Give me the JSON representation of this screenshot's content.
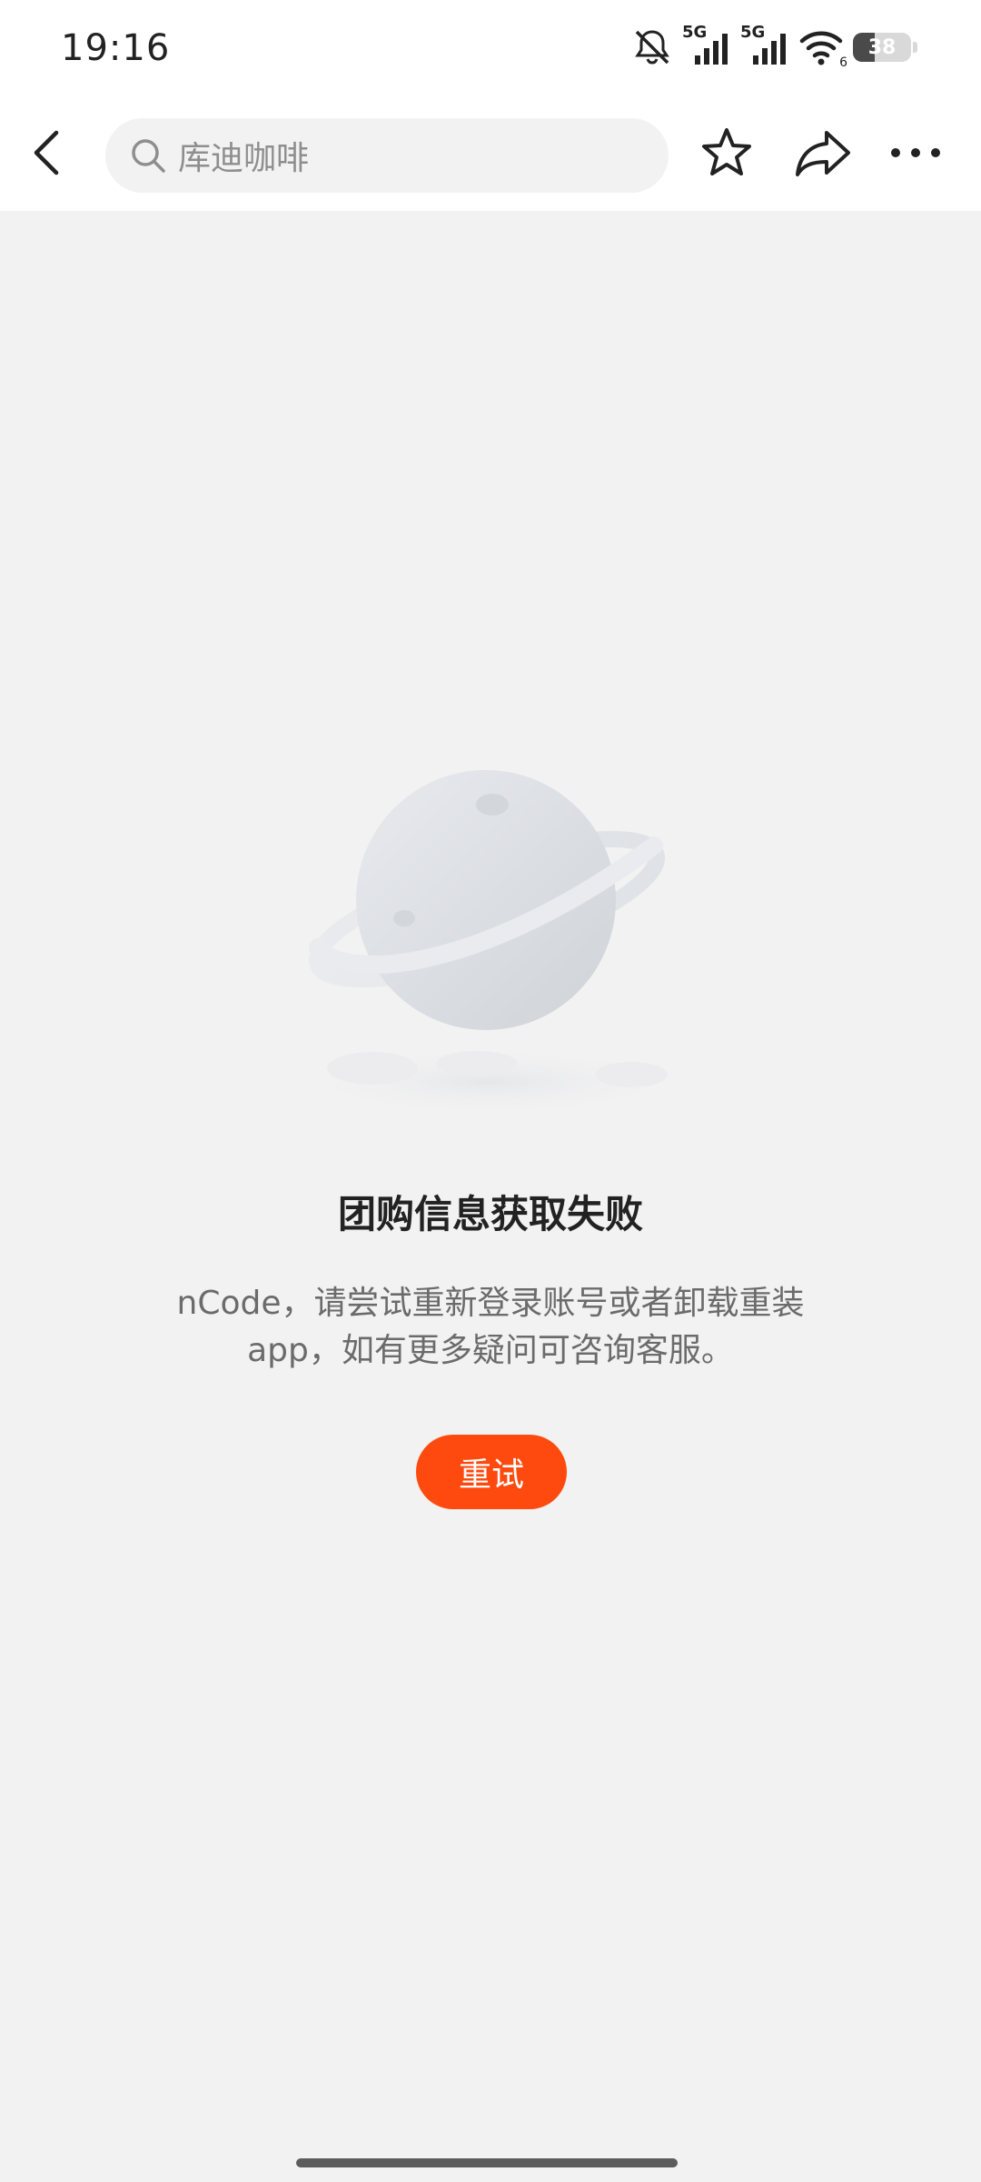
{
  "status_bar": {
    "time": "19:16",
    "network_1": "5G",
    "network_2": "5G",
    "wifi_sub": "6",
    "battery": "38",
    "battery_level_percent": 38
  },
  "nav": {
    "search_text": "库迪咖啡",
    "icons": [
      "back-arrow-icon",
      "search-icon",
      "star-icon",
      "share-icon",
      "more-icon"
    ]
  },
  "empty_state": {
    "title": "团购信息获取失败",
    "description": "nCode，请尝试重新登录账号或者卸载重装app，如有更多疑问可咨询客服。",
    "retry_label": "重试"
  },
  "colors": {
    "accent": "#ff4a0f",
    "background": "#f2f2f2"
  }
}
